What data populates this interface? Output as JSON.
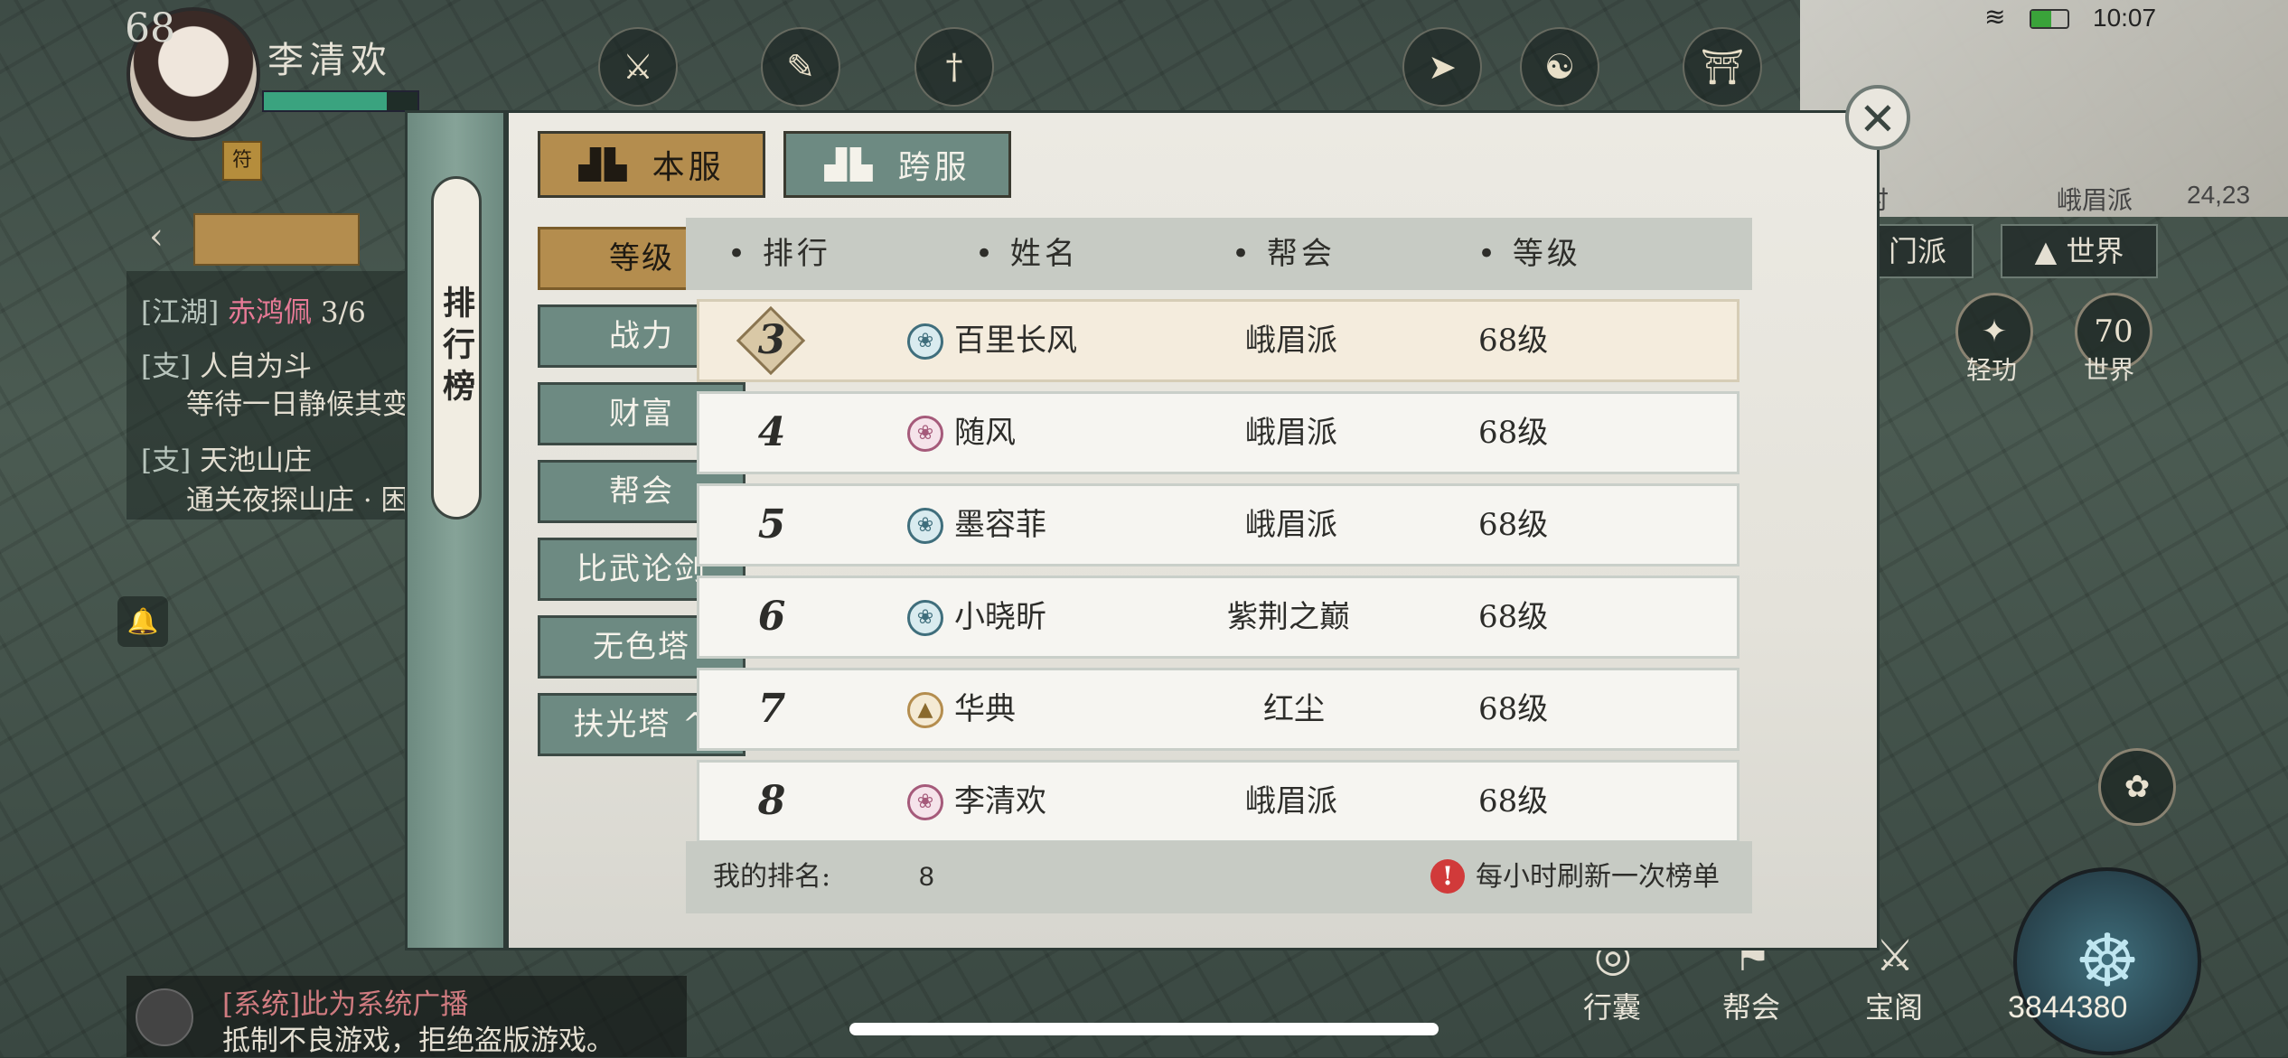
{
  "player": {
    "level": "68",
    "name": "李清欢",
    "hp_fraction": 0.8
  },
  "status_bar": {
    "time": "10:07"
  },
  "minimap": {
    "time_text": "时",
    "location": "峨眉派",
    "coords": "24,23"
  },
  "quests": [
    {
      "tag": "[江湖]",
      "title": "赤鸿佩",
      "progress": "3/6"
    },
    {
      "tag": "[支]",
      "title": "人自为斗",
      "detail": "等待一日静候其变"
    },
    {
      "tag": "[支]",
      "title": "天池山庄",
      "detail": "通关夜探山庄 · 困"
    }
  ],
  "chat": {
    "line1_tag": "[系统]",
    "line1": "此为系统广播",
    "line2": "抵制不良游戏，拒绝盗版游戏。"
  },
  "side_buttons": {
    "faction": "门派",
    "world": "世界"
  },
  "round_buttons": [
    {
      "label": "轻功",
      "glyph": "✦"
    },
    {
      "label": "世界",
      "glyph": "70"
    }
  ],
  "bottom_menu": [
    {
      "label": "行囊",
      "glyph": "◎"
    },
    {
      "label": "帮会",
      "glyph": "⚑"
    },
    {
      "label": "宝阁",
      "glyph": "⚔"
    }
  ],
  "currency": "3844380",
  "leaderboard": {
    "spine_title": "排行榜",
    "tabs": {
      "local": "本服",
      "cross": "跨服"
    },
    "categories": [
      "等级",
      "战力",
      "财富",
      "帮会",
      "比武论剑",
      "无色塔",
      "扶光塔 ^"
    ],
    "active_category": "等级",
    "headers": {
      "rank": "排行",
      "name": "姓名",
      "guild": "帮会",
      "level": "等级"
    },
    "rows": [
      {
        "rank": "3",
        "name": "百里长风",
        "guild": "峨眉派",
        "level": "68级",
        "icon": "lotus-blue"
      },
      {
        "rank": "4",
        "name": "随风",
        "guild": "峨眉派",
        "level": "68级",
        "icon": "lotus-pink"
      },
      {
        "rank": "5",
        "name": "墨容菲",
        "guild": "峨眉派",
        "level": "68级",
        "icon": "lotus-blue"
      },
      {
        "rank": "6",
        "name": "小晓昕",
        "guild": "紫荆之巅",
        "level": "68级",
        "icon": "lotus-blue"
      },
      {
        "rank": "7",
        "name": "华典",
        "guild": "红尘",
        "level": "68级",
        "icon": "pagoda-gold"
      },
      {
        "rank": "8",
        "name": "李清欢",
        "guild": "峨眉派",
        "level": "68级",
        "icon": "lotus-pink"
      }
    ],
    "footer": {
      "my_rank_label": "我的排名:",
      "my_rank_value": "8",
      "refresh_note": "每小时刷新一次榜单"
    }
  },
  "colors": {
    "accent_gold": "#b48d4e",
    "tab_green": "#6d8a82",
    "alert_red": "#d13a3a"
  }
}
